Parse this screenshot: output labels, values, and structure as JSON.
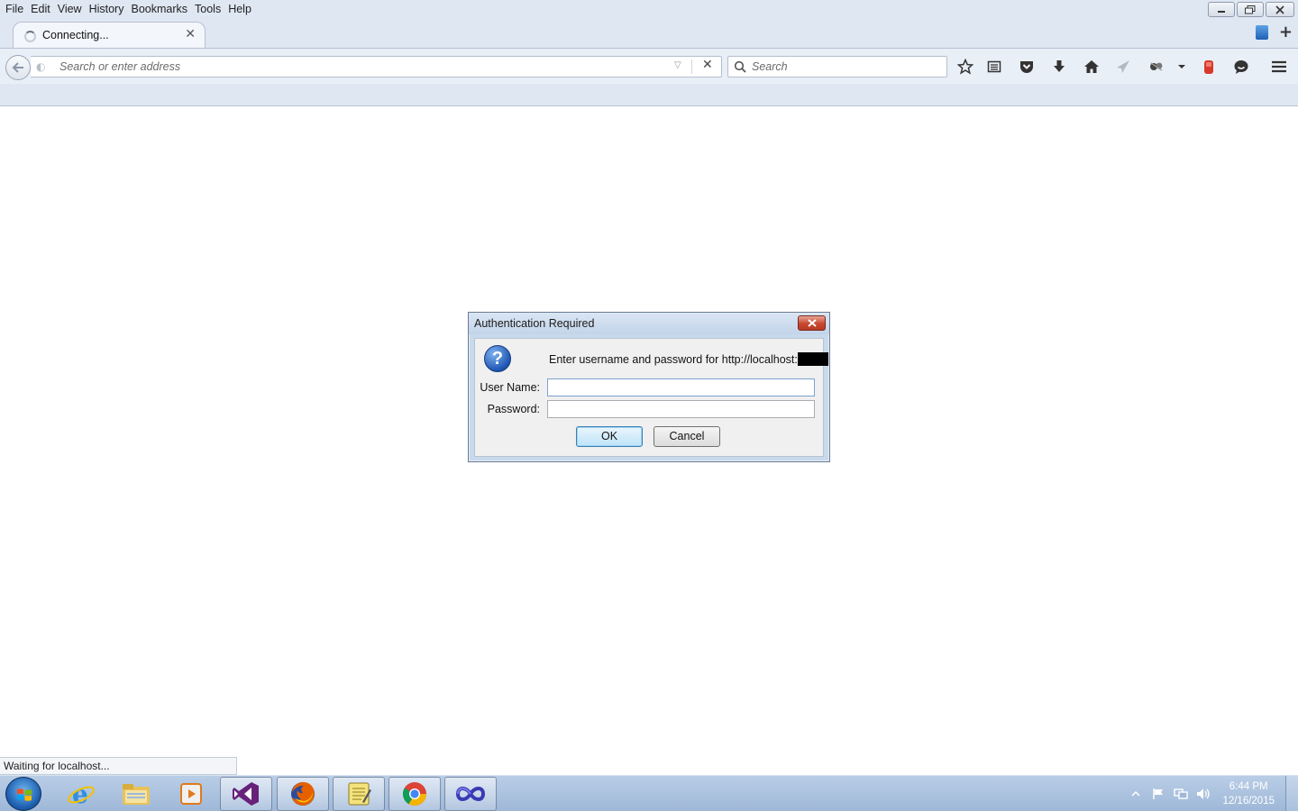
{
  "menubar": {
    "items": [
      {
        "label": "File"
      },
      {
        "label": "Edit"
      },
      {
        "label": "View"
      },
      {
        "label": "History"
      },
      {
        "label": "Bookmarks"
      },
      {
        "label": "Tools"
      },
      {
        "label": "Help"
      }
    ]
  },
  "tab": {
    "title": "Connecting...",
    "close": "✕"
  },
  "navbar": {
    "url_placeholder": "Search or enter address",
    "search_placeholder": "Search"
  },
  "dialog": {
    "title": "Authentication Required",
    "message": "Enter username and password for http://localhost:",
    "username_label": "User Name:",
    "password_label": "Password:",
    "username_value": "",
    "password_value": "",
    "ok_label": "OK",
    "cancel_label": "Cancel"
  },
  "status": {
    "text": "Waiting for localhost..."
  },
  "taskbar": {
    "apps": [
      {
        "name": "internet-explorer",
        "icon": "ie-icon"
      },
      {
        "name": "file-explorer",
        "icon": "folder-icon"
      },
      {
        "name": "media-player",
        "icon": "media-player-icon"
      },
      {
        "name": "visual-studio",
        "icon": "visual-studio-icon"
      },
      {
        "name": "firefox",
        "icon": "firefox-icon",
        "active": true
      },
      {
        "name": "notepad-app",
        "icon": "notes-icon"
      },
      {
        "name": "chrome",
        "icon": "chrome-icon"
      },
      {
        "name": "infinity-app",
        "icon": "infinity-icon"
      }
    ],
    "clock_time": "6:44 PM",
    "clock_date": "12/16/2015"
  },
  "colors": {
    "chrome_bg": "#dfe7f3",
    "taskbar": "#9fb8d8",
    "dialog_close_red": "#c7472f"
  }
}
